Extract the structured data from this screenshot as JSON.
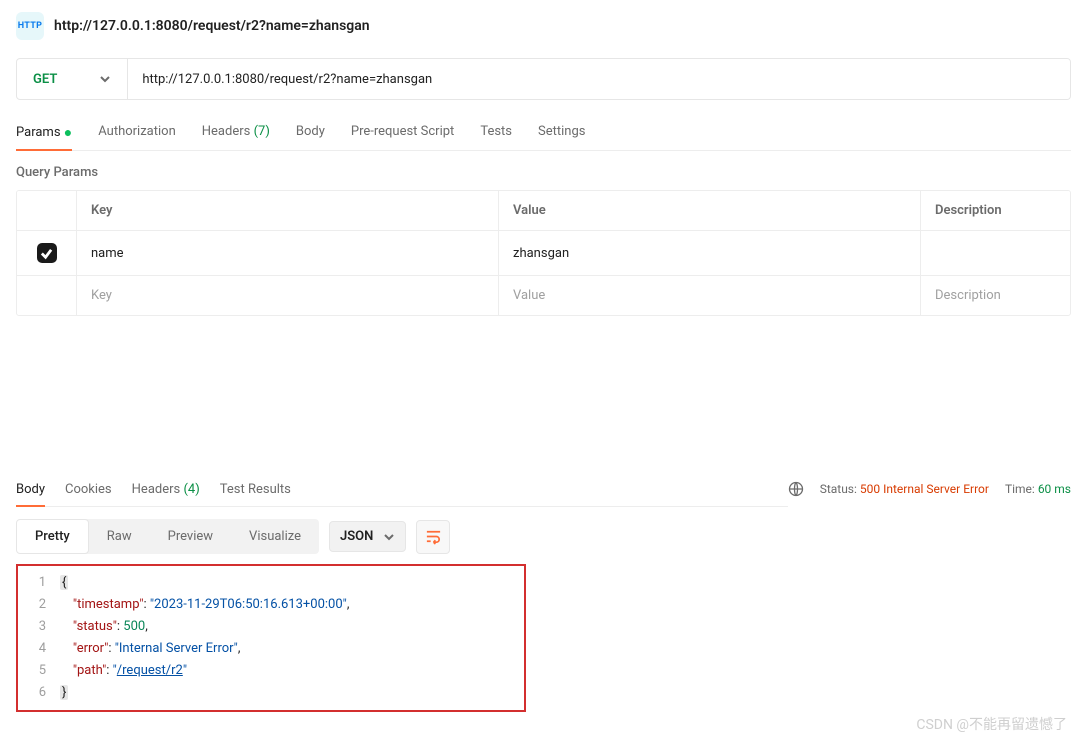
{
  "header": {
    "badge_text": "HTTP",
    "title_url": "http://127.0.0.1:8080/request/r2?name=zhansgan"
  },
  "request": {
    "method": "GET",
    "url": "http://127.0.0.1:8080/request/r2?name=zhansgan"
  },
  "tabs": {
    "params": "Params",
    "authorization": "Authorization",
    "headers": "Headers",
    "headers_count": "(7)",
    "body": "Body",
    "prerequest": "Pre-request Script",
    "tests": "Tests",
    "settings": "Settings"
  },
  "params_section": {
    "title": "Query Params",
    "head_key": "Key",
    "head_value": "Value",
    "head_desc": "Description",
    "row1_key": "name",
    "row1_value": "zhansgan",
    "ph_key": "Key",
    "ph_value": "Value",
    "ph_desc": "Description"
  },
  "resp_tabs": {
    "body": "Body",
    "cookies": "Cookies",
    "headers": "Headers",
    "headers_count": "(4)",
    "tests": "Test Results"
  },
  "resp_meta": {
    "status_label": "Status:",
    "status_value": "500 Internal Server Error",
    "time_label": "Time:",
    "time_value": "60 ms"
  },
  "viewbar": {
    "pretty": "Pretty",
    "raw": "Raw",
    "preview": "Preview",
    "visualize": "Visualize",
    "format": "JSON"
  },
  "json_body": {
    "timestamp_k": "\"timestamp\"",
    "timestamp_v": "\"2023-11-29T06:50:16.613+00:00\"",
    "status_k": "\"status\"",
    "status_v": "500",
    "error_k": "\"error\"",
    "error_v": "\"Internal Server Error\"",
    "path_k": "\"path\"",
    "path_v": "/request/r2"
  },
  "watermark": "CSDN @不能再留遗憾了"
}
